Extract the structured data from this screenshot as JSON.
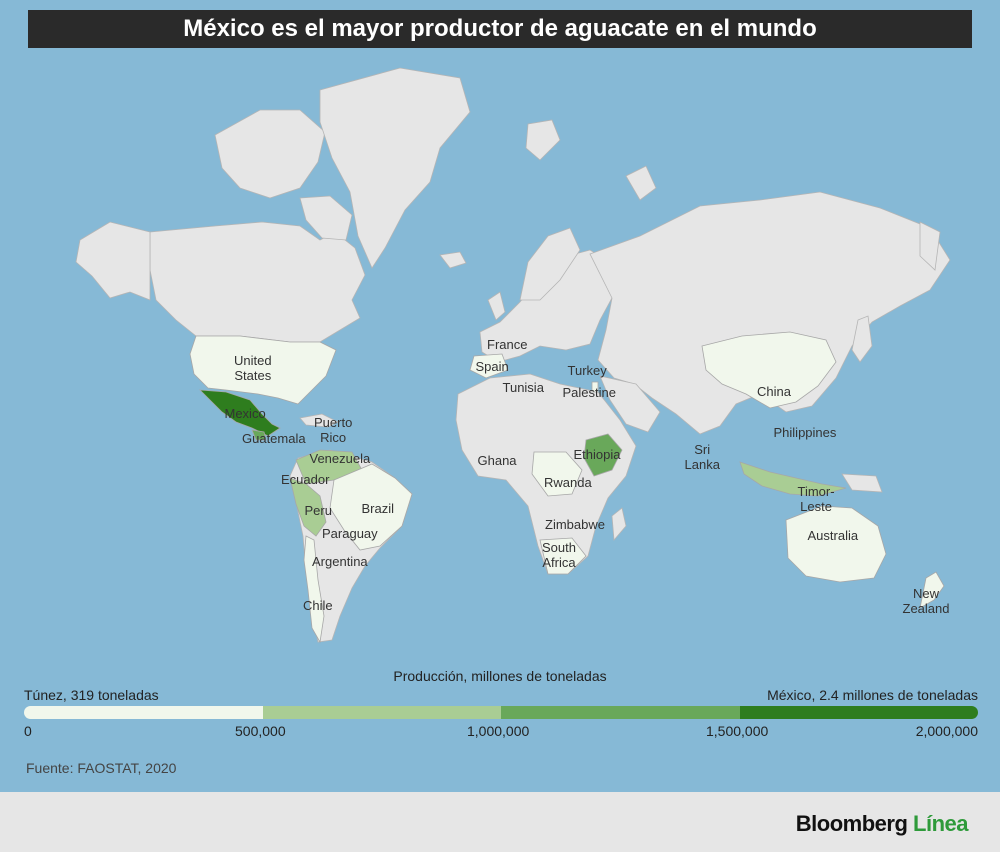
{
  "title": "México es el mayor productor de aguacate en el mundo",
  "colors": {
    "ocean": "#86b9d6",
    "no_data": "#e6e6e6",
    "scale": [
      "#f1f7ec",
      "#a9cd94",
      "#69a85a",
      "#2e7d1e"
    ],
    "title_bg": "#2a2a2a",
    "brand_green": "#2e9a3a"
  },
  "countries": [
    {
      "name": "United States",
      "lines": [
        "United",
        "States"
      ]
    },
    {
      "name": "Mexico",
      "lines": [
        "Mexico"
      ]
    },
    {
      "name": "Guatemala",
      "lines": [
        "Guatemala"
      ]
    },
    {
      "name": "Puerto Rico",
      "lines": [
        "Puerto",
        "Rico"
      ]
    },
    {
      "name": "Venezuela",
      "lines": [
        "Venezuela"
      ]
    },
    {
      "name": "Ecuador",
      "lines": [
        "Ecuador"
      ]
    },
    {
      "name": "Peru",
      "lines": [
        "Peru"
      ]
    },
    {
      "name": "Brazil",
      "lines": [
        "Brazil"
      ]
    },
    {
      "name": "Paraguay",
      "lines": [
        "Paraguay"
      ]
    },
    {
      "name": "Argentina",
      "lines": [
        "Argentina"
      ]
    },
    {
      "name": "Chile",
      "lines": [
        "Chile"
      ]
    },
    {
      "name": "France",
      "lines": [
        "France"
      ]
    },
    {
      "name": "Spain",
      "lines": [
        "Spain"
      ]
    },
    {
      "name": "Tunisia",
      "lines": [
        "Tunisia"
      ]
    },
    {
      "name": "Turkey",
      "lines": [
        "Turkey"
      ]
    },
    {
      "name": "Palestine",
      "lines": [
        "Palestine"
      ]
    },
    {
      "name": "Ghana",
      "lines": [
        "Ghana"
      ]
    },
    {
      "name": "Ethiopia",
      "lines": [
        "Ethiopia"
      ]
    },
    {
      "name": "Rwanda",
      "lines": [
        "Rwanda"
      ]
    },
    {
      "name": "Zimbabwe",
      "lines": [
        "Zimbabwe"
      ]
    },
    {
      "name": "South Africa",
      "lines": [
        "South",
        "Africa"
      ]
    },
    {
      "name": "China",
      "lines": [
        "China"
      ]
    },
    {
      "name": "Sri Lanka",
      "lines": [
        "Sri",
        "Lanka"
      ]
    },
    {
      "name": "Philippines",
      "lines": [
        "Philippines"
      ]
    },
    {
      "name": "Timor-Leste",
      "lines": [
        "Timor-",
        "Leste"
      ]
    },
    {
      "name": "Australia",
      "lines": [
        "Australia"
      ]
    },
    {
      "name": "New Zealand",
      "lines": [
        "New",
        "Zealand"
      ]
    }
  ],
  "legend": {
    "caption": "Producción, millones de toneladas",
    "min_label": "Túnez, 319 toneladas",
    "max_label": "México, 2.4 millones de toneladas",
    "ticks": [
      "0",
      "500,000",
      "1,000,000",
      "1,500,000",
      "2,000,000"
    ]
  },
  "source": "Fuente: FAOSTAT, 2020",
  "brand": {
    "part1": "Bloomberg",
    "part2": "Línea"
  }
}
